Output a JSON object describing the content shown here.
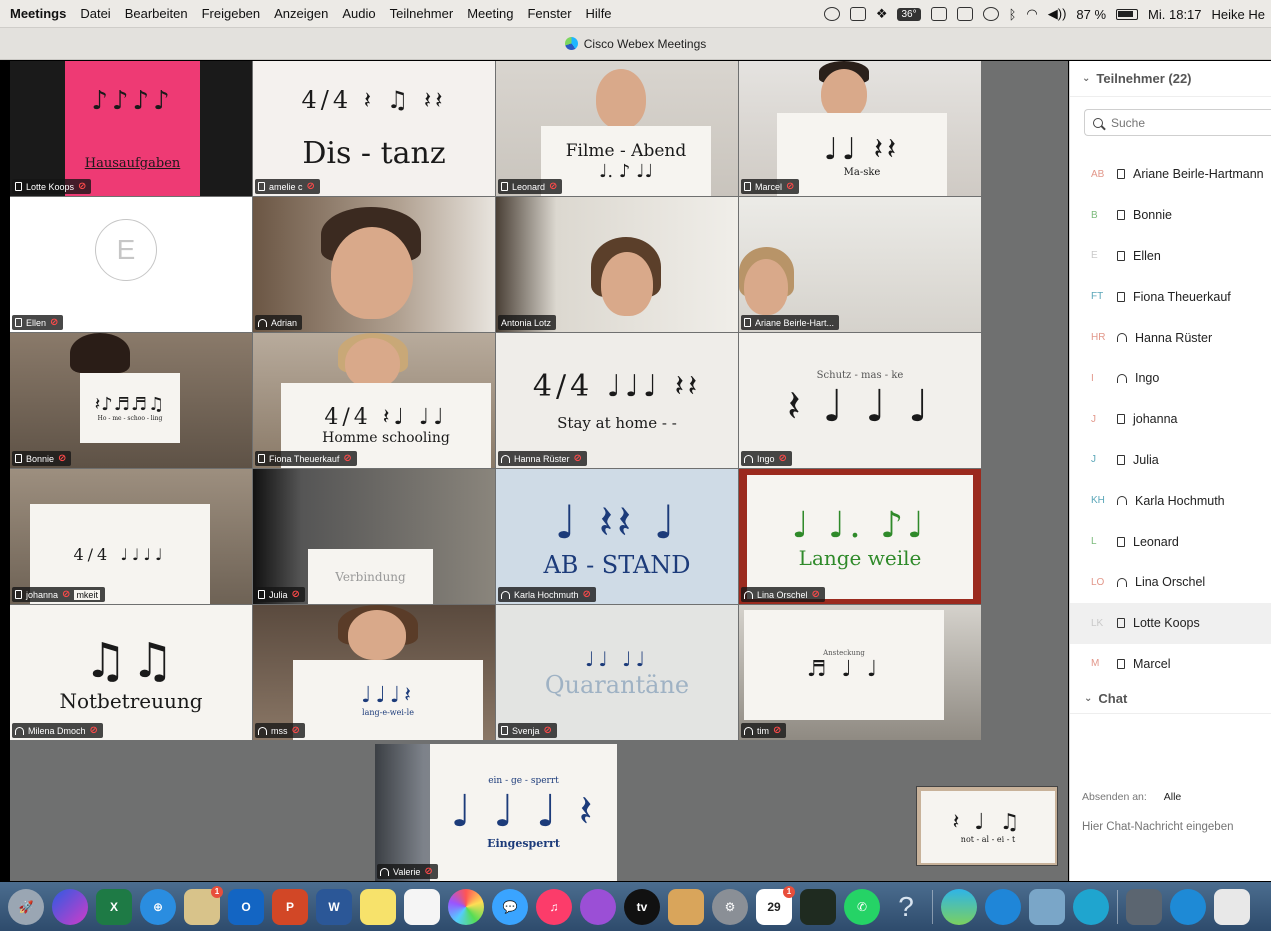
{
  "menubar": {
    "app": "Meetings",
    "items": [
      "Datei",
      "Bearbeiten",
      "Freigeben",
      "Anzeigen",
      "Audio",
      "Teilnehmer",
      "Meeting",
      "Fenster",
      "Hilfe"
    ],
    "temperature": "36°",
    "battery": "87 %",
    "clock": "Mi. 18:17",
    "user": "Heike He"
  },
  "window": {
    "title": "Cisco Webex Meetings"
  },
  "tiles": [
    {
      "name": "Lotte Koops",
      "sign": "Hausaufgaben",
      "notes": "♪♪♪♪"
    },
    {
      "name": "amelie c",
      "sign": "Dis - tanz",
      "notes": "4/4 𝄽 ♫ 𝄽𝄽"
    },
    {
      "name": "Leonard",
      "sign": "Filme - Abend",
      "notes": "♩. ♪ ♩♩"
    },
    {
      "name": "Marcel",
      "sign": "Ma-ske",
      "notes": "♩♩ 𝄽𝄽"
    },
    {
      "name": "Ellen",
      "avatar": "E"
    },
    {
      "name": "Adrian"
    },
    {
      "name": "Antonia Lotz"
    },
    {
      "name": "Ariane Beirle-Hart..."
    },
    {
      "name": "Bonnie",
      "sign": "Ho - me - schoo - ling",
      "notes": "𝄽♪♬♬♫"
    },
    {
      "name": "Fiona Theuerkauf",
      "sign": "Homme schooling",
      "notes": "4/4 𝄽♩ ♩♩"
    },
    {
      "name": "Hanna Rüster",
      "sign": "Stay at home - -",
      "notes": "4/4 ♩♩♩ 𝄽𝄽"
    },
    {
      "name": "Ingo",
      "sign": "Schutz - mas - ke",
      "notes": "𝄽 ♩ ♩ ♩"
    },
    {
      "name": "johanna",
      "sign": "mkeit",
      "notes": "4/4 ♩♩♩♩"
    },
    {
      "name": "Julia",
      "sign": "Verbindung",
      "notes": ""
    },
    {
      "name": "Karla Hochmuth",
      "sign": "AB - STAND",
      "notes": "♩ 𝄽𝄽 ♩"
    },
    {
      "name": "Lina Orschel",
      "sign": "Lange weile",
      "notes": "♩ ♩. ♪♩"
    },
    {
      "name": "Milena Dmoch",
      "sign": "Notbetreuung",
      "notes": "♫♫"
    },
    {
      "name": "mss",
      "sign": "lang-e-wei-le",
      "notes": "♩♩♩𝄽"
    },
    {
      "name": "Svenja",
      "sign": "Quarantäne",
      "notes": "♩♩ ♩♩"
    },
    {
      "name": "tim",
      "sign": "Ansteckung",
      "notes": "♬ ♩ ♩"
    },
    {
      "name": "Valerie",
      "sign": "Eingesperrt",
      "notes": "♩ ♩ ♩ 𝄽",
      "words": "ein - ge - sperrt"
    }
  ],
  "selfview": {
    "sign": "not - al - ei - t",
    "notes": "𝄽 ♩ ♫"
  },
  "sidebar": {
    "participants_header": "Teilnehmer (22)",
    "search_placeholder": "Suche",
    "participants": [
      {
        "initials": "AB",
        "name": "Ariane Beirle-Hartmann",
        "device": "phone"
      },
      {
        "initials": "B",
        "name": "Bonnie",
        "device": "phone"
      },
      {
        "initials": "E",
        "name": "Ellen",
        "device": "phone"
      },
      {
        "initials": "FT",
        "name": "Fiona Theuerkauf",
        "device": "phone"
      },
      {
        "initials": "HR",
        "name": "Hanna Rüster",
        "device": "headset"
      },
      {
        "initials": "I",
        "name": "Ingo",
        "device": "headset"
      },
      {
        "initials": "J",
        "name": "johanna",
        "device": "phone"
      },
      {
        "initials": "J",
        "name": "Julia",
        "device": "phone"
      },
      {
        "initials": "KH",
        "name": "Karla Hochmuth",
        "device": "headset"
      },
      {
        "initials": "L",
        "name": "Leonard",
        "device": "phone"
      },
      {
        "initials": "LO",
        "name": "Lina Orschel",
        "device": "headset"
      },
      {
        "initials": "LK",
        "name": "Lotte Koops",
        "device": "phone"
      },
      {
        "initials": "M",
        "name": "Marcel",
        "device": "phone"
      }
    ],
    "chat_header": "Chat",
    "send_to_label": "Absenden an:",
    "send_to_value": "Alle",
    "chat_placeholder": "Hier Chat-Nachricht eingeben"
  },
  "dock": {
    "excel_label": "X",
    "word_label": "W",
    "powerpoint_label": "P",
    "outlook_label": "O",
    "tv_label": "tv",
    "calendar_day": "29",
    "help_label": "?",
    "badges": {
      "preview": "1",
      "calendar": "1"
    }
  }
}
